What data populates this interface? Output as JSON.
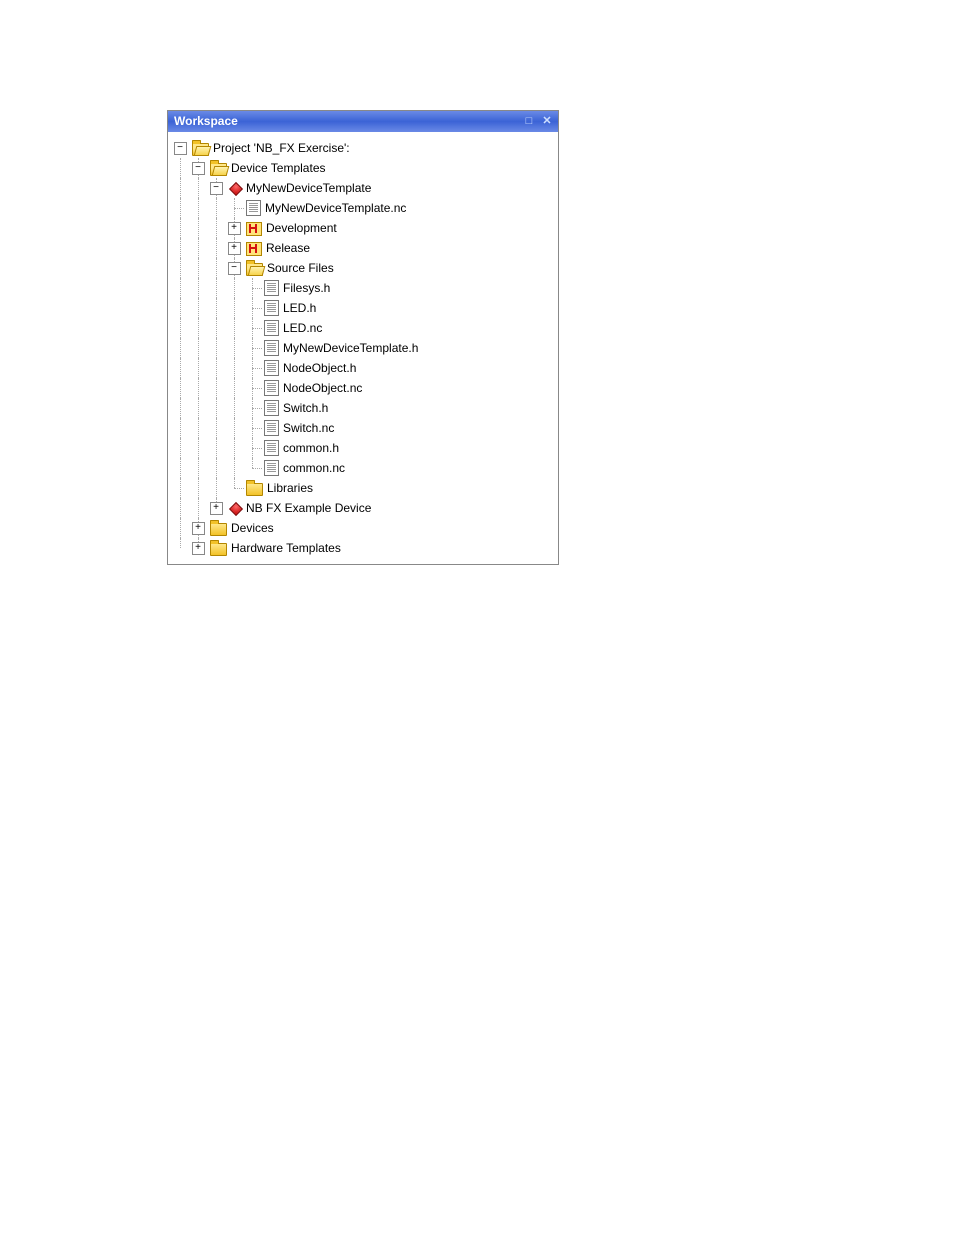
{
  "titlebar": {
    "title": "Workspace"
  },
  "tree": {
    "root": {
      "label": "Project 'NB_FX Exercise':",
      "device_templates": {
        "label": "Device Templates",
        "my_new_device": {
          "label": "MyNewDeviceTemplate",
          "nc_file": "MyNewDeviceTemplate.nc",
          "development": "Development",
          "release": "Release",
          "source_files": {
            "label": "Source Files",
            "files": [
              "Filesys.h",
              "LED.h",
              "LED.nc",
              "MyNewDeviceTemplate.h",
              "NodeObject.h",
              "NodeObject.nc",
              "Switch.h",
              "Switch.nc",
              "common.h",
              "common.nc"
            ]
          },
          "libraries": "Libraries"
        },
        "nb_fx_example": "NB FX Example Device"
      },
      "devices": "Devices",
      "hardware_templates": "Hardware Templates"
    }
  }
}
